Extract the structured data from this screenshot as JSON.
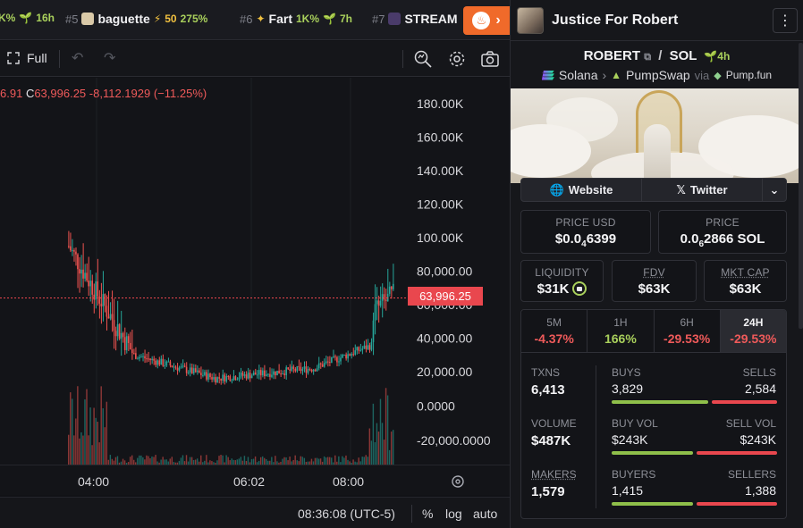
{
  "ticker": {
    "items": [
      {
        "rank": "",
        "name": "",
        "pct": "K%",
        "age": "16h"
      },
      {
        "rank": "#5",
        "name": "baguette",
        "boost": "50",
        "pct": "275%",
        "age": ""
      },
      {
        "rank": "#6",
        "name": "Fart",
        "pct": "1K%",
        "age": "7h"
      },
      {
        "rank": "#7",
        "name": "STREAM",
        "pct": "",
        "age": ""
      }
    ]
  },
  "toolbar": {
    "full_label": "Full"
  },
  "chart": {
    "ohlc_prefix": "6.91",
    "close_label": "C",
    "close_value": "63,996.25",
    "change": "-8,112.1929 (−11.25%)",
    "last_price": "63,996.25",
    "y_ticks": [
      "180.00K",
      "160.00K",
      "140.00K",
      "120.00K",
      "100.00K",
      "80,000.00",
      "60,000.00",
      "40,000.00",
      "20,000.00",
      "0.0000",
      "-20,000.0000"
    ],
    "x_ticks": [
      "04:00",
      "06:02",
      "08:00"
    ]
  },
  "bottombar": {
    "time": "08:36:08 (UTC-5)",
    "percent": "%",
    "log": "log",
    "auto": "auto"
  },
  "colors": {
    "up": "#26a69a",
    "down": "#ef5350",
    "accent": "#f06a2a",
    "positive": "#a9d05c"
  },
  "panel": {
    "title": "Justice For Robert",
    "pair_base": "ROBERT",
    "pair_quote": "SOL",
    "pair_age": "4h",
    "chain": "Solana",
    "dex": "PumpSwap",
    "via": "via",
    "launchpad": "Pump.fun",
    "links": {
      "website": "Website",
      "twitter": "Twitter"
    },
    "price_usd": {
      "label": "PRICE USD",
      "value_a": "$0.0",
      "value_sub": "4",
      "value_b": "6399"
    },
    "price_sol": {
      "label": "PRICE",
      "value_a": "0.0",
      "value_sub": "6",
      "value_b": "2866 SOL"
    },
    "liquidity": {
      "label": "LIQUIDITY",
      "value": "$31K"
    },
    "fdv": {
      "label": "FDV",
      "value": "$63K"
    },
    "mktcap": {
      "label": "MKT CAP",
      "value": "$63K"
    },
    "tabs": [
      {
        "label": "5M",
        "value": "-4.37%",
        "tone": "neg"
      },
      {
        "label": "1H",
        "value": "166%",
        "tone": "pos"
      },
      {
        "label": "6H",
        "value": "-29.53%",
        "tone": "neg"
      },
      {
        "label": "24H",
        "value": "-29.53%",
        "tone": "neg"
      }
    ],
    "stats": {
      "txns_label": "TXNS",
      "txns": "6,413",
      "buys_label": "BUYS",
      "buys": "3,829",
      "sells_label": "SELLS",
      "sells": "2,584",
      "volume_label": "VOLUME",
      "volume": "$487K",
      "buy_vol_label": "BUY VOL",
      "buy_vol": "$243K",
      "sell_vol_label": "SELL VOL",
      "sell_vol": "$243K",
      "makers_label": "MAKERS",
      "makers": "1,579",
      "buyers_label": "BUYERS",
      "buyers": "1,415",
      "sellers_label": "SELLERS",
      "sellers": "1,388",
      "buy_share": 0.597,
      "buy_vol_share": 0.5,
      "buyer_share": 0.505
    }
  }
}
